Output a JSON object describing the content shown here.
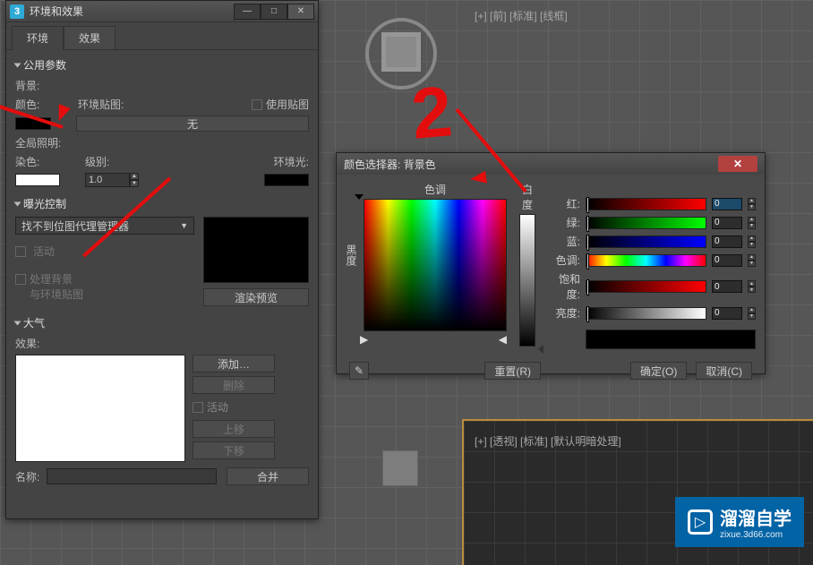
{
  "viewport": {
    "label_top": "[+] [前] [标准] [线框]",
    "label_persp": "[+] [透视] [标准] [默认明暗处理]"
  },
  "annotation": {
    "big_number": "2"
  },
  "env_window": {
    "title": "环境和效果",
    "tabs": {
      "env": "环境",
      "fx": "效果"
    },
    "common": {
      "header": "公用参数",
      "background": "背景:",
      "color": "颜色:",
      "env_map": "环境贴图:",
      "use_map": "使用贴图",
      "none": "无",
      "global_illum": "全局照明:",
      "tint": "染色:",
      "level": "级别:",
      "level_val": "1.0",
      "ambient": "环境光:"
    },
    "exposure": {
      "header": "曝光控制",
      "manager": "找不到位图代理管理器",
      "active": "活动",
      "process_bg": "处理背景",
      "with_env": "与环境贴图",
      "render_preview": "渲染预览"
    },
    "atmos": {
      "header": "大气",
      "effects": "效果:",
      "add": "添加…",
      "delete": "删除",
      "active": "活动",
      "move_up": "上移",
      "move_down": "下移",
      "merge": "合并",
      "name": "名称:"
    }
  },
  "color_picker": {
    "title": "颜色选择器: 背景色",
    "hue": "色调",
    "whiteness": "白度",
    "blackness": "黑度",
    "red": "红:",
    "green": "绿:",
    "blue": "蓝:",
    "hue_l": "色调:",
    "sat": "饱和度:",
    "val": "亮度:",
    "values": {
      "r": "0",
      "g": "0",
      "b": "0",
      "h": "0",
      "s": "0",
      "v": "0"
    },
    "reset": "重置(R)",
    "ok": "确定(O)",
    "cancel": "取消(C)"
  },
  "watermark": {
    "text": "溜溜自学",
    "url": "zixue.3d66.com"
  }
}
